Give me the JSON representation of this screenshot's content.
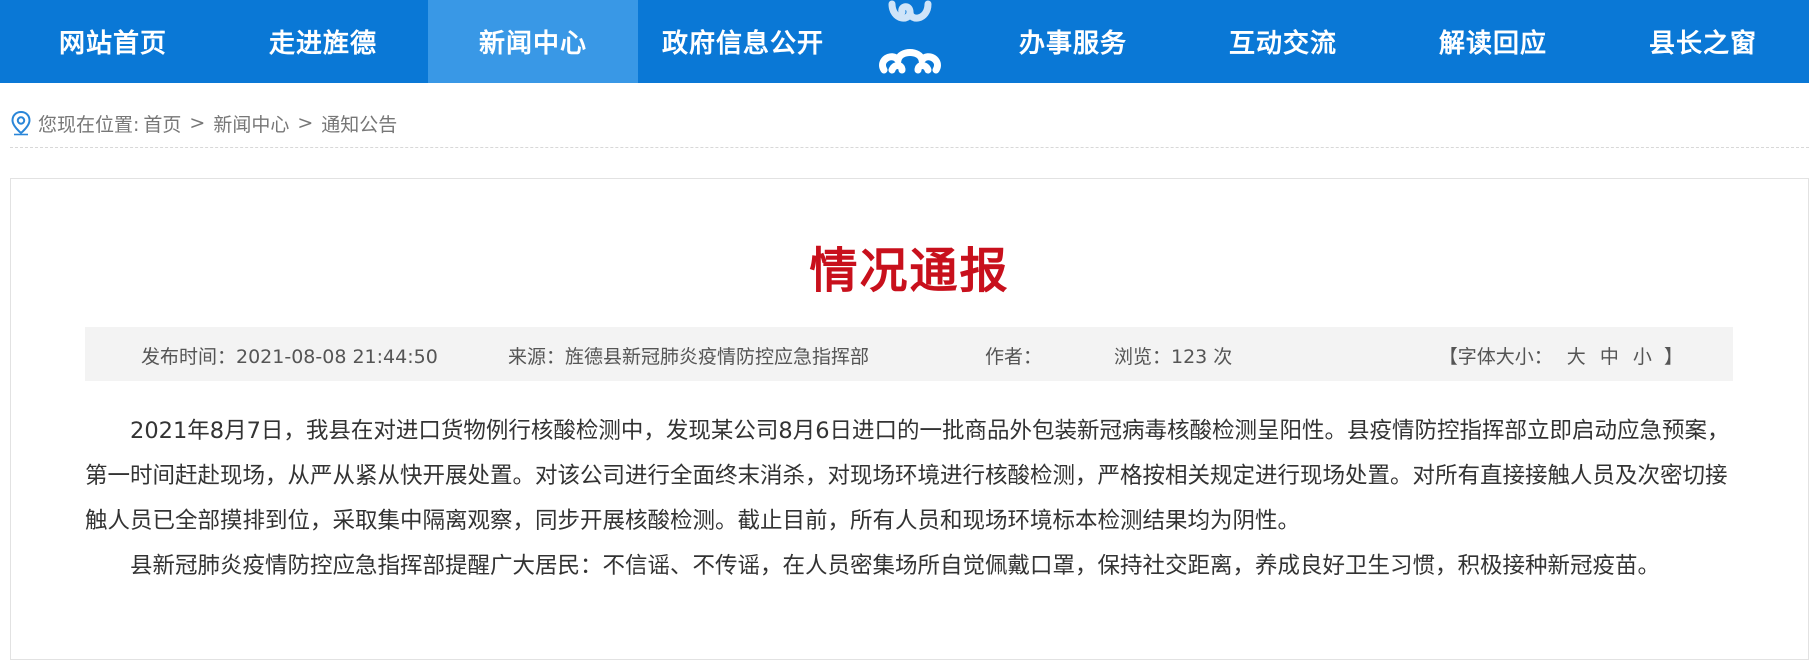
{
  "nav": {
    "left_items": [
      "网站首页",
      "走进旌德",
      "新闻中心",
      "政府信息公开"
    ],
    "right_items": [
      "办事服务",
      "互动交流",
      "解读回应",
      "县长之窗"
    ],
    "active": "新闻中心"
  },
  "breadcrumb": {
    "prefix": "您现在位置:",
    "items": [
      "首页",
      "新闻中心",
      "通知公告"
    ],
    "separator": ">"
  },
  "article": {
    "title": "情况通报",
    "meta": {
      "publish_time": "发布时间：2021-08-08 21:44:50",
      "source": "来源：旌德县新冠肺炎疫情防控应急指挥部",
      "author": "作者：",
      "views": "浏览：123 次",
      "font_size_label": "【字体大小：",
      "font_large": "大",
      "font_medium": "中",
      "font_small": "小",
      "font_size_close": "】"
    },
    "paragraphs": [
      "2021年8月7日，我县在对进口货物例行核酸检测中，发现某公司8月6日进口的一批商品外包装新冠病毒核酸检测呈阳性。县疫情防控指挥部立即启动应急预案，第一时间赶赴现场，从严从紧从快开展处置。对该公司进行全面终末消杀，对现场环境进行核酸检测，严格按相关规定进行现场处置。对所有直接接触人员及次密切接触人员已全部摸排到位，采取集中隔离观察，同步开展核酸检测。截止目前，所有人员和现场环境标本检测结果均为阴性。",
      "县新冠肺炎疫情防控应急指挥部提醒广大居民：不信谣、不传谣，在人员密集场所自觉佩戴口罩，保持社交距离，养成良好卫生习惯，积极接种新冠疫苗。"
    ]
  },
  "colors": {
    "nav_bg": "#0a78d6",
    "nav_active": "#3998e6",
    "title": "#c8101c"
  }
}
